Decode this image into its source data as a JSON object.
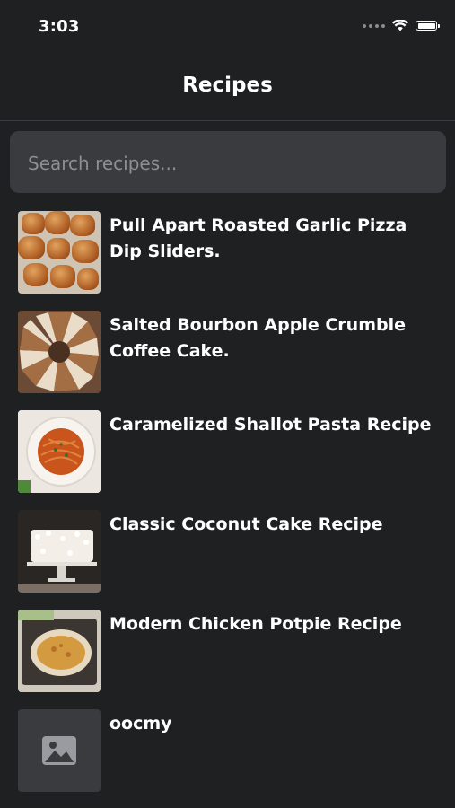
{
  "status_bar": {
    "time": "3:03"
  },
  "nav": {
    "title": "Recipes"
  },
  "search": {
    "placeholder": "Search recipes...",
    "value": ""
  },
  "recipes": [
    {
      "title": "Pull Apart Roasted Garlic Pizza Dip Sliders.",
      "image": "pizza-sliders-photo"
    },
    {
      "title": "Salted Bourbon Apple Crumble Coffee Cake.",
      "image": "coffee-cake-photo"
    },
    {
      "title": "Caramelized Shallot Pasta Recipe",
      "image": "pasta-photo"
    },
    {
      "title": "Classic Coconut Cake Recipe",
      "image": "coconut-cake-photo"
    },
    {
      "title": "Modern Chicken Potpie Recipe",
      "image": "potpie-photo"
    },
    {
      "title": "oocmy",
      "image": "image-placeholder-icon"
    }
  ],
  "colors": {
    "background": "#1f2022",
    "search_field": "#3a3b3f",
    "placeholder_text": "#8e8f93",
    "text": "#ffffff"
  }
}
